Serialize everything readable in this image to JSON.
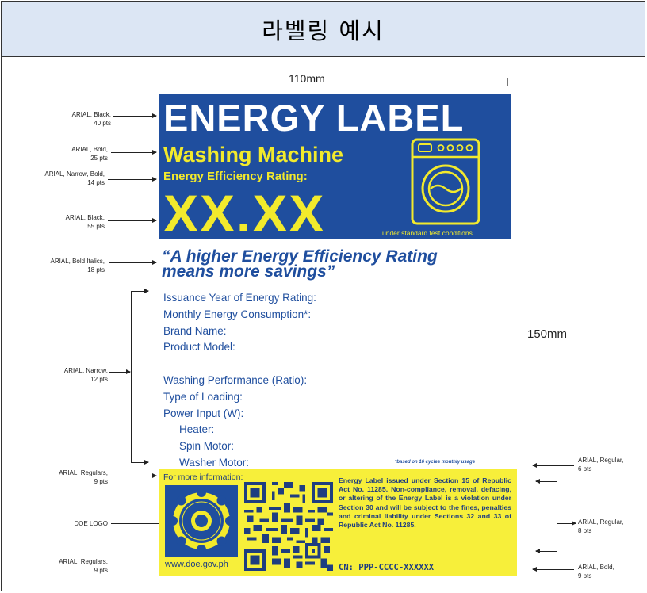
{
  "header": {
    "title": "라벨링 예시"
  },
  "dimensions": {
    "width": "110mm",
    "height": "150mm"
  },
  "label": {
    "title": "ENERGY LABEL",
    "appliance": "Washing Machine",
    "rating_label": "Energy Efficiency Rating:",
    "rating_value": "XX.XX",
    "standard_note": "under standard test conditions",
    "slogan_line1": "“A higher Energy Efficiency Rating",
    "slogan_line2": "means more savings”",
    "fields": [
      "Issuance Year of Energy Rating:",
      "Monthly Energy Consumption*:",
      "Brand Name:",
      "Product Model:",
      "Washing Performance (Ratio):",
      "Type of Loading:",
      "Power Input (W):"
    ],
    "sub_fields": [
      "Heater:",
      "Spin Motor:",
      "Washer Motor:"
    ],
    "footnote": "*based on 16 cycles monthly usage",
    "more_info": "For more information:",
    "website": "www.doe.gov.ph",
    "legal_text": "Energy Label issued under Section 15 of Republic Act No. 11285. Non-compliance, removal, defacing, or altering of the Energy Label is a violation under Section 30 and will be subject to the fines, penalties and criminal liability under Sections 32 and 33 of Republic Act No. 11285.",
    "cn": "CN: PPP-CCCC-XXXXXX"
  },
  "annotations": {
    "left": [
      {
        "line1": "ARIAL, Black,",
        "line2": "40 pts"
      },
      {
        "line1": "ARIAL, Bold,",
        "line2": "25 pts"
      },
      {
        "line1": "ARIAL, Narrow, Bold,",
        "line2": "14 pts"
      },
      {
        "line1": "ARIAL, Black,",
        "line2": "55 pts"
      },
      {
        "line1": "ARIAL, Bold Italics,",
        "line2": "18 pts"
      },
      {
        "line1": "ARIAL, Narrow,",
        "line2": "12 pts"
      },
      {
        "line1": "ARIAL, Regulars,",
        "line2": "9 pts"
      },
      {
        "line1": "DOE LOGO",
        "line2": ""
      },
      {
        "line1": "ARIAL, Regulars,",
        "line2": "9 pts"
      }
    ],
    "right": [
      {
        "line1": "ARIAL, Regular,",
        "line2": "6 pts"
      },
      {
        "line1": "ARIAL, Regular,",
        "line2": "8 pts"
      },
      {
        "line1": "ARIAL, Bold,",
        "line2": "9 pts"
      }
    ]
  },
  "colors": {
    "label_blue": "#1f4e9e",
    "label_yellow": "#f2ea2c",
    "header_bg": "#dce6f4"
  }
}
